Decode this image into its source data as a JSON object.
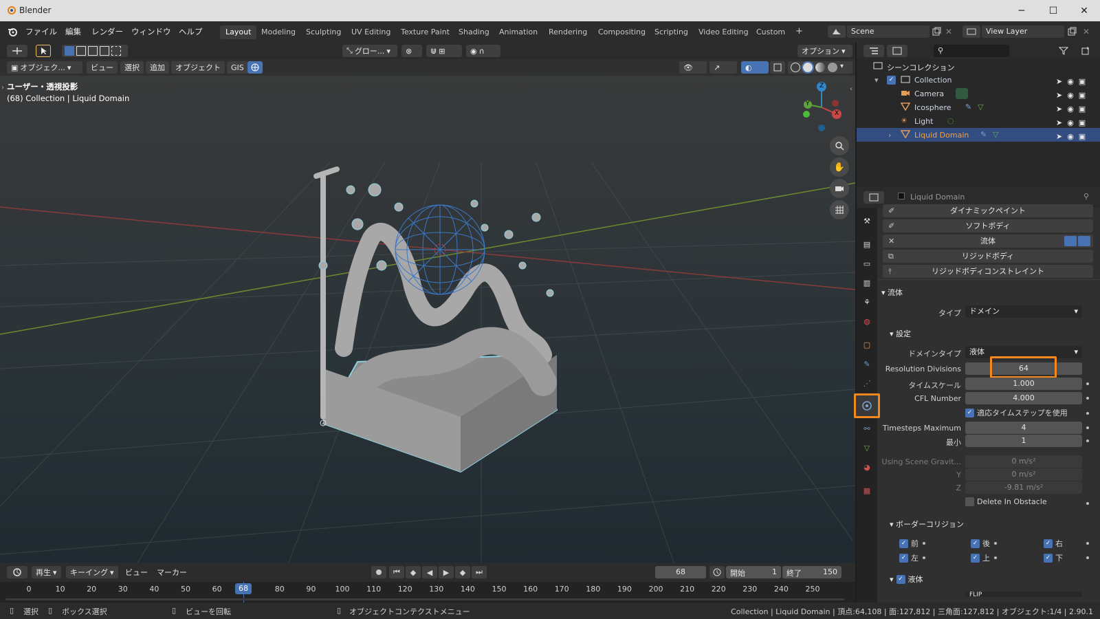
{
  "window": {
    "title": "Blender",
    "minimize": "─",
    "maximize": "☐",
    "close": "✕"
  },
  "menubar": [
    "ファイル",
    "編集",
    "レンダー",
    "ウィンドウ",
    "ヘルプ"
  ],
  "workspaces": [
    "Layout",
    "Modeling",
    "Sculpting",
    "UV Editing",
    "Texture Paint",
    "Shading",
    "Animation",
    "Rendering",
    "Compositing",
    "Scripting",
    "Video Editing",
    "Custom"
  ],
  "workspace_add": "+",
  "scene": {
    "name": "Scene",
    "view_layer": "View Layer"
  },
  "toolheader": {
    "orientation": "グロー...",
    "options": "オプション"
  },
  "viewport_header": {
    "mode": "オブジェク...",
    "view": "ビュー",
    "select": "選択",
    "add": "追加",
    "object": "オブジェクト",
    "gis": "GIS"
  },
  "viewport_overlay": {
    "line1": "ユーザー・透視投影",
    "line2": "(68) Collection | Liquid Domain"
  },
  "gizmo": {
    "z": "Z",
    "y": "Y",
    "x": "X"
  },
  "outliner": {
    "scene_collection": "シーンコレクション",
    "items": [
      {
        "label": "Collection"
      },
      {
        "label": "Camera"
      },
      {
        "label": "Icosphere"
      },
      {
        "label": "Light"
      },
      {
        "label": "Liquid Domain"
      }
    ]
  },
  "properties": {
    "object_name": "Liquid Domain",
    "physics_buttons": [
      "ダイナミックペイント",
      "ソフトボディ",
      "流体",
      "リジッドボディ",
      "リジッドボディコンストレイント"
    ],
    "fluid_remove": "✕",
    "fluid_header": "流体",
    "type_label": "タイプ",
    "type_value": "ドメイン",
    "settings_header": "設定",
    "domain_type_label": "ドメインタイプ",
    "domain_type_value": "液体",
    "resolution_label": "Resolution Divisions",
    "resolution_value": "64",
    "timescale_label": "タイムスケール",
    "timescale_value": "1.000",
    "cfl_label": "CFL Number",
    "cfl_value": "4.000",
    "adaptive_label": "適応タイムステップを使用",
    "tsmax_label": "Timesteps Maximum",
    "tsmax_value": "4",
    "tsmin_label": "最小",
    "tsmin_value": "1",
    "gravity_label": "Using Scene Gravit...",
    "gravity_x": "0 m/s²",
    "gravity_y_label": "Y",
    "gravity_y": "0 m/s²",
    "gravity_z_label": "Z",
    "gravity_z": "-9.81 m/s²",
    "delete_obstacle_label": "Delete In Obstacle",
    "border_header": "ボーダーコリジョン",
    "border": {
      "front": "前",
      "back": "後",
      "right": "右",
      "left": "左",
      "top": "上",
      "bottom": "下"
    },
    "liquid_header": "液体",
    "liquid_row_value": "FLIP"
  },
  "timeline": {
    "playback": "再生",
    "keying": "キーイング",
    "view": "ビュー",
    "marker": "マーカー",
    "current_frame": "68",
    "start_label": "開始",
    "start": "1",
    "end_label": "終了",
    "end": "150",
    "ticks": [
      "0",
      "10",
      "20",
      "30",
      "40",
      "50",
      "60",
      "68",
      "80",
      "90",
      "100",
      "110",
      "120",
      "130",
      "140",
      "150",
      "160",
      "170",
      "180",
      "190",
      "200",
      "210",
      "220",
      "230",
      "240",
      "250"
    ]
  },
  "statusbar": {
    "select": "選択",
    "box_select": "ボックス選択",
    "rotate": "ビューを回転",
    "context": "オブジェクトコンテクストメニュー",
    "info": "Collection | Liquid Domain | 頂点:64,108 | 面:127,812 | 三角面:127,812 | オブジェクト:1/4 | 2.90.1"
  },
  "colors": {
    "accent": "#4772b3",
    "highlight": "#f5891f",
    "selected_row": "#334d80"
  }
}
